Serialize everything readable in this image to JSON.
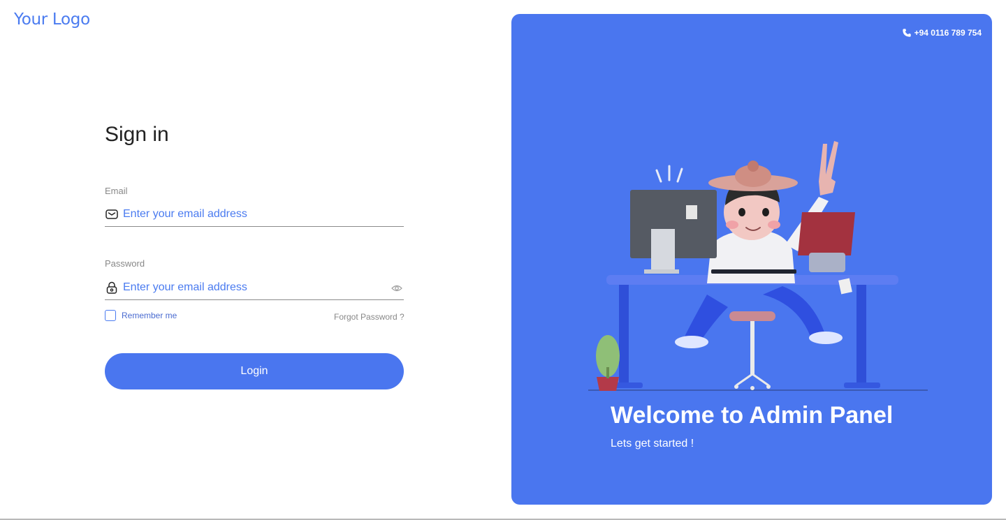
{
  "brand": {
    "logo_text": "Your Logo",
    "accent": "#4a76ef"
  },
  "form": {
    "title": "Sign in",
    "email": {
      "label": "Email",
      "placeholder": "Enter your email address",
      "icon": "envelope-icon"
    },
    "password": {
      "label": "Password",
      "placeholder": "Enter your email address",
      "icon": "lock-icon",
      "toggle_icon": "eye-icon"
    },
    "remember_label": "Remember me",
    "forgot_label": "Forgot Password ?",
    "login_label": "Login"
  },
  "panel": {
    "phone": "+94 0116 789 754",
    "phone_icon": "phone-icon",
    "welcome": "Welcome to Admin Panel",
    "tagline": "Lets get started !",
    "illustration": "person-at-desk-illustration"
  }
}
